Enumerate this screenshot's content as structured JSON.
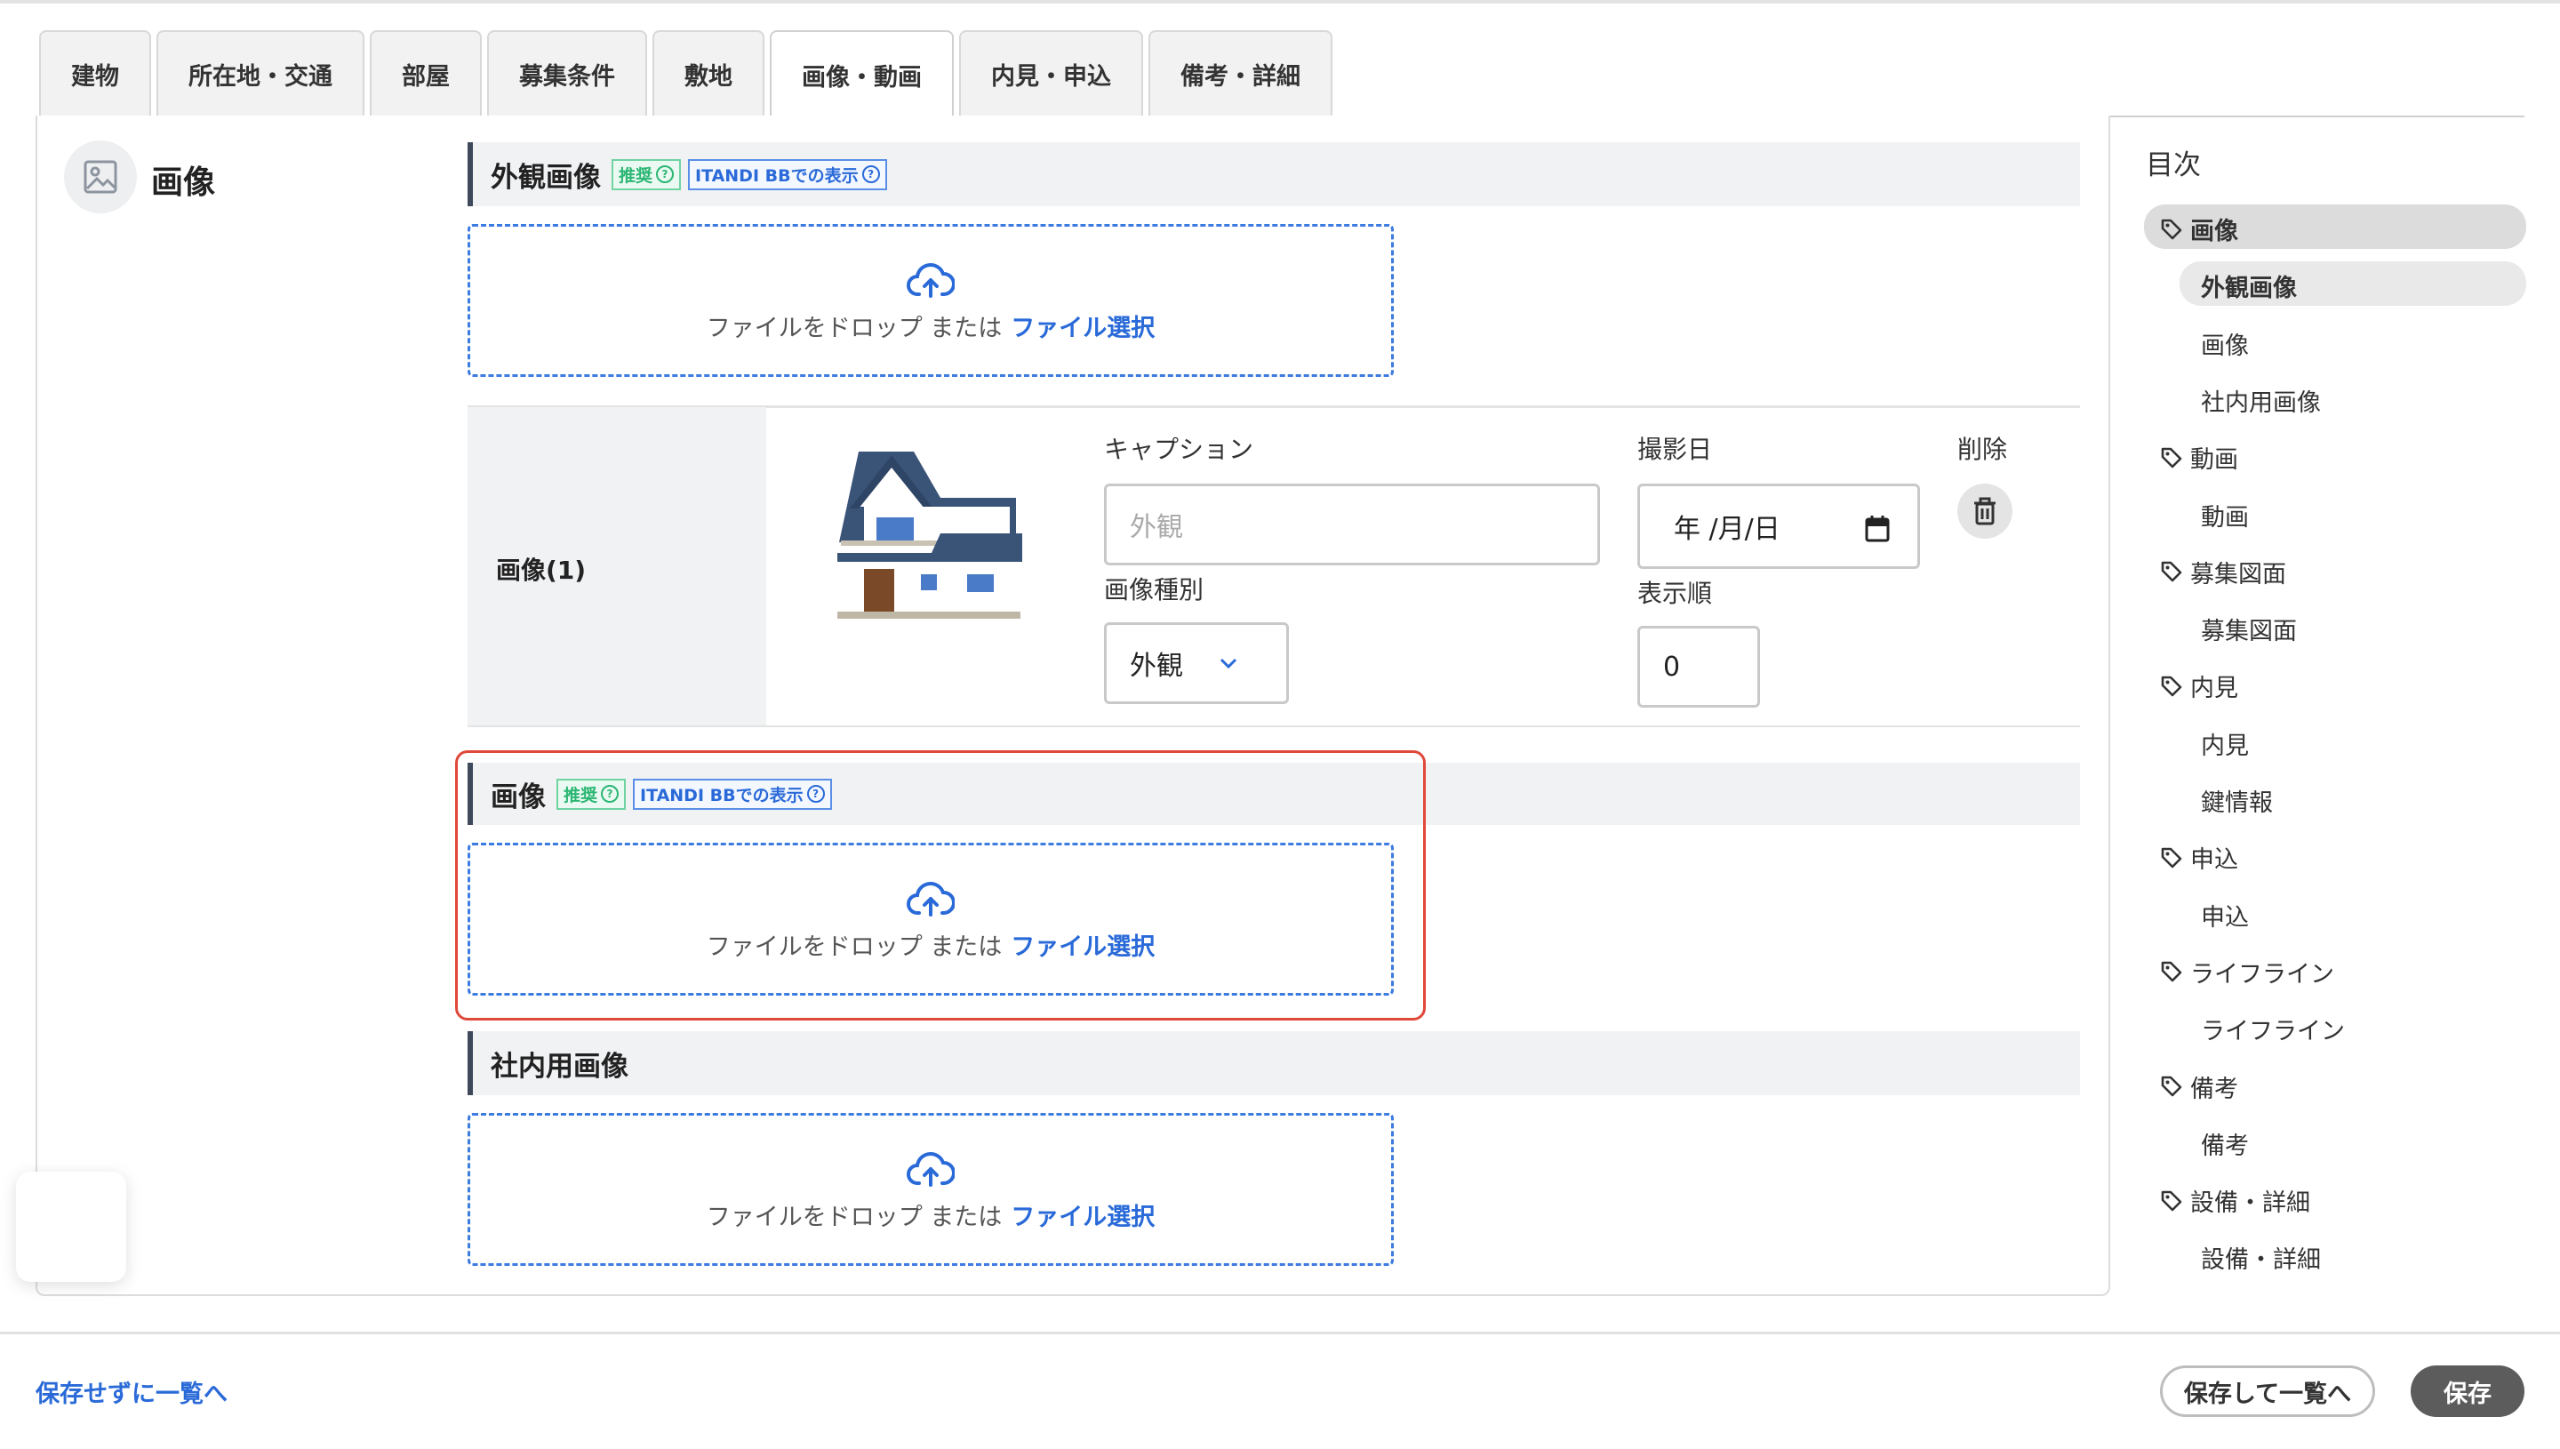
{
  "tabs": [
    "建物",
    "所在地・交通",
    "部屋",
    "募集条件",
    "敷地",
    "画像・動画",
    "内見・申込",
    "備考・詳細"
  ],
  "active_tab": "画像・動画",
  "section": {
    "title": "画像",
    "icon": "image-icon"
  },
  "blocks": {
    "exterior": {
      "title": "外観画像",
      "badge_recommended": "推奨",
      "badge_itandi": "ITANDI BBでの表示"
    },
    "images": {
      "title": "画像",
      "badge_recommended": "推奨",
      "badge_itandi": "ITANDI BBでの表示"
    },
    "internal": {
      "title": "社内用画像"
    }
  },
  "dropzone": {
    "text": "ファイルをドロップ または",
    "link": "ファイル選択",
    "icon": "cloud-upload-icon"
  },
  "image_row": {
    "label": "画像(1)",
    "caption_label": "キャプション",
    "caption_placeholder": "外観",
    "type_label": "画像種別",
    "type_value": "外観",
    "date_label": "撮影日",
    "date_value": "年 /月/日",
    "order_label": "表示順",
    "order_value": "0",
    "delete_label": "削除"
  },
  "toc": {
    "title": "目次",
    "items": [
      {
        "label": "画像",
        "level": 1,
        "active": true
      },
      {
        "label": "外観画像",
        "level": 2,
        "active": true
      },
      {
        "label": "画像",
        "level": 2
      },
      {
        "label": "社内用画像",
        "level": 2
      },
      {
        "label": "動画",
        "level": 1
      },
      {
        "label": "動画",
        "level": 2
      },
      {
        "label": "募集図面",
        "level": 1
      },
      {
        "label": "募集図面",
        "level": 2
      },
      {
        "label": "内見",
        "level": 1
      },
      {
        "label": "内見",
        "level": 2
      },
      {
        "label": "鍵情報",
        "level": 2
      },
      {
        "label": "申込",
        "level": 1
      },
      {
        "label": "申込",
        "level": 2
      },
      {
        "label": "ライフライン",
        "level": 1
      },
      {
        "label": "ライフライン",
        "level": 2
      },
      {
        "label": "備考",
        "level": 1
      },
      {
        "label": "備考",
        "level": 2
      },
      {
        "label": "設備・詳細",
        "level": 1
      },
      {
        "label": "設備・詳細",
        "level": 2
      }
    ]
  },
  "footer": {
    "back_link": "保存せずに一覧へ",
    "save_and_list": "保存して一覧へ",
    "save": "保存"
  },
  "colors": {
    "accent_blue": "#2a6ad8",
    "highlight_red": "#e0483a",
    "header_bar": "#3e4a5c"
  }
}
